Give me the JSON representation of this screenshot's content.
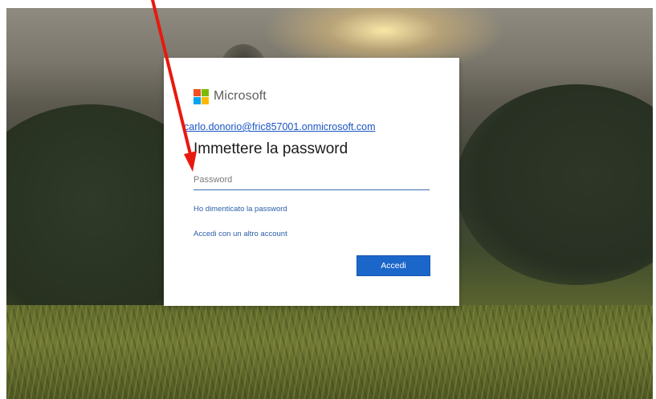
{
  "brand": {
    "name": "Microsoft",
    "logo_colors": [
      "#f25022",
      "#7fba00",
      "#00a4ef",
      "#ffb900"
    ]
  },
  "login": {
    "account_email": "carlo.donorio@fric857001.onmicrosoft.com",
    "heading": "Immettere la password",
    "password_placeholder": "Password",
    "forgot_password_link": "Ho dimenticato la password",
    "other_account_link": "Accedi con un altro account",
    "signin_button": "Accedi"
  },
  "annotation": {
    "arrow_color": "#e8190f"
  },
  "colors": {
    "accent": "#1b66c9",
    "link": "#2a5ea8"
  }
}
